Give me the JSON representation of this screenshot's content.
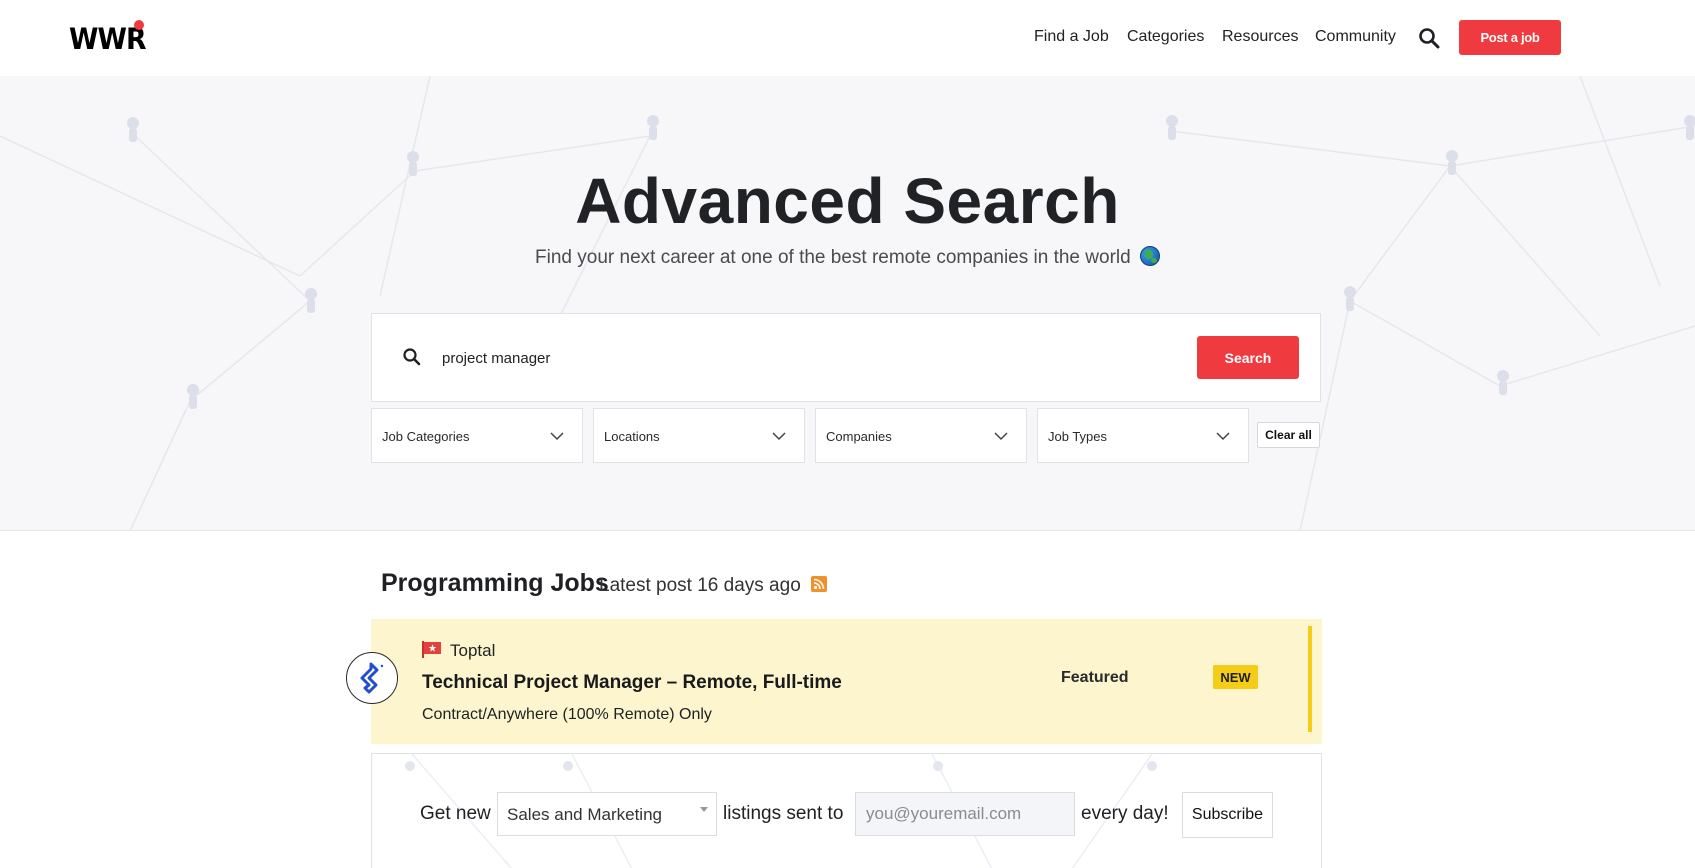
{
  "brand": {
    "logo_text": "WWR",
    "accent_color": "#ef3a3f"
  },
  "nav": {
    "items": [
      {
        "label": "Find a Job"
      },
      {
        "label": "Categories"
      },
      {
        "label": "Resources"
      },
      {
        "label": "Community"
      }
    ],
    "search_icon": "search-icon",
    "post_job_label": "Post a job"
  },
  "hero": {
    "title": "Advanced Search",
    "subtitle": "Find your next career at one of the best remote companies in the world",
    "search_value": "project manager",
    "search_button": "Search",
    "filters": [
      {
        "label": "Job Categories"
      },
      {
        "label": "Locations"
      },
      {
        "label": "Companies"
      },
      {
        "label": "Job Types"
      }
    ],
    "clear_all": "Clear all"
  },
  "section": {
    "title": "Programming Jobs",
    "latest": "Latest post 16 days ago",
    "rss_icon": "rss-icon"
  },
  "jobs": [
    {
      "company": "Toptal",
      "title": "Technical Project Manager – Remote, Full-time",
      "meta": "Contract/Anywhere (100% Remote) Only",
      "featured_label": "Featured",
      "badge": "NEW",
      "highlight_color": "#fcf5cd"
    }
  ],
  "subscribe": {
    "prefix": "Get new",
    "category_value": "Sales and Marketing",
    "middle": "listings sent to",
    "email_placeholder": "you@youremail.com",
    "suffix": "every day!",
    "button": "Subscribe"
  }
}
